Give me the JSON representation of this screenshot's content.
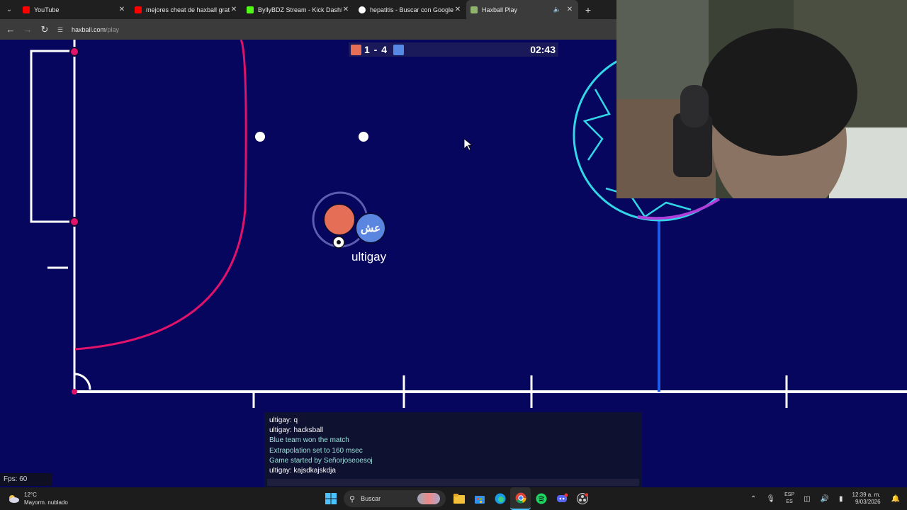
{
  "browser": {
    "tabs": [
      {
        "title": "YouTube",
        "favicon_color": "#ff0000",
        "active": false
      },
      {
        "title": "mejores cheat de haxball gratis",
        "favicon_color": "#ff0000",
        "active": false
      },
      {
        "title": "ByllyBDZ Stream - Kick Dashbo",
        "favicon_color": "#53fc18",
        "active": false
      },
      {
        "title": "hepatitis - Buscar con Google",
        "favicon_color": "#4285f4",
        "active": false
      },
      {
        "title": "Haxball Play",
        "favicon_color": "#8fb46e",
        "active": true
      }
    ],
    "new_tab_label": "+",
    "url_host": "haxball.com",
    "url_path": "/play"
  },
  "game": {
    "score": "1 - 4",
    "timer": "02:43",
    "red_color": "#e56e56",
    "blue_color": "#5689e5",
    "player_name": "ultigay",
    "blue_avatar": "عش"
  },
  "chat": {
    "messages": [
      {
        "text": "ultigay: q",
        "kind": "user"
      },
      {
        "text": "ultigay: hacksball",
        "kind": "user"
      },
      {
        "text": "Blue team won the match",
        "kind": "sys"
      },
      {
        "text": "Extrapolation set to 160 msec",
        "kind": "sys"
      },
      {
        "text": "Game started by Señorjoseoesoj",
        "kind": "sys"
      },
      {
        "text": "ultigay: kajsdkajskdja",
        "kind": "user"
      }
    ]
  },
  "fps": "Fps: 60",
  "taskbar": {
    "weather_temp": "12°C",
    "weather_desc": "Mayorm. nublado",
    "search_label": "Buscar",
    "lang_top": "ESP",
    "lang_bottom": "ES",
    "time": "12:39 a. m.",
    "date": "9/03/2026"
  }
}
